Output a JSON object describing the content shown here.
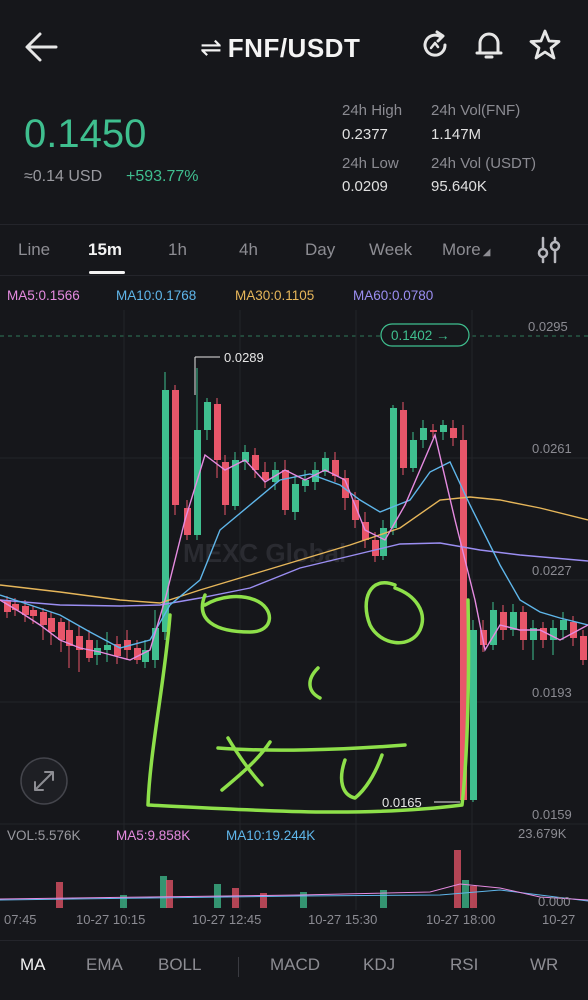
{
  "header": {
    "pair": "FNF/USDT",
    "swap_glyph": "⇌",
    "icons": [
      "back-arrow-icon",
      "refresh-icon",
      "bell-icon",
      "star-icon"
    ]
  },
  "ticker": {
    "price": "0.1450",
    "fiat": "≈0.14 USD",
    "change": "+593.77%",
    "high_label": "24h High",
    "high": "0.2377",
    "low_label": "24h Low",
    "low": "0.0209",
    "vol_fnf_label": "24h Vol(FNF)",
    "vol_fnf": "1.147M",
    "vol_usdt_label": "24h Vol (USDT)",
    "vol_usdt": "95.640K"
  },
  "timeframes": [
    "Line",
    "15m",
    "1h",
    "4h",
    "Day",
    "Week",
    "More"
  ],
  "active_timeframe": "15m",
  "ma_legend": {
    "ma5": "MA5:0.1566",
    "ma10": "MA10:0.1768",
    "ma30": "MA30:0.1105",
    "ma60": "MA60:0.0780"
  },
  "colors": {
    "up": "#3fbf8f",
    "down": "#e8566a",
    "ma5": "#e58be0",
    "ma10": "#5fb6ea",
    "ma30": "#e6b65a",
    "ma60": "#9b8ef2",
    "drawing": "#8ee04a"
  },
  "chart": {
    "y_axis": [
      "0.0295",
      "0.0261",
      "0.0227",
      "0.0193",
      "0.0159"
    ],
    "current_tag": "0.1402 →",
    "high_marker": "0.0289",
    "low_marker": "0.0165",
    "watermark": "MEXC Global"
  },
  "volume": {
    "vol": "VOL:5.576K",
    "ma5": "MA5:9.858K",
    "ma10": "MA10:19.244K",
    "max": "23.679K",
    "zero": "0.000"
  },
  "x_axis": [
    "07:45",
    "10-27 10:15",
    "10-27 12:45",
    "10-27 15:30",
    "10-27 18:00",
    "10-27"
  ],
  "indicators": [
    "MA",
    "EMA",
    "BOLL",
    "MACD",
    "KDJ",
    "RSI",
    "WR"
  ],
  "active_indicator": "MA"
}
